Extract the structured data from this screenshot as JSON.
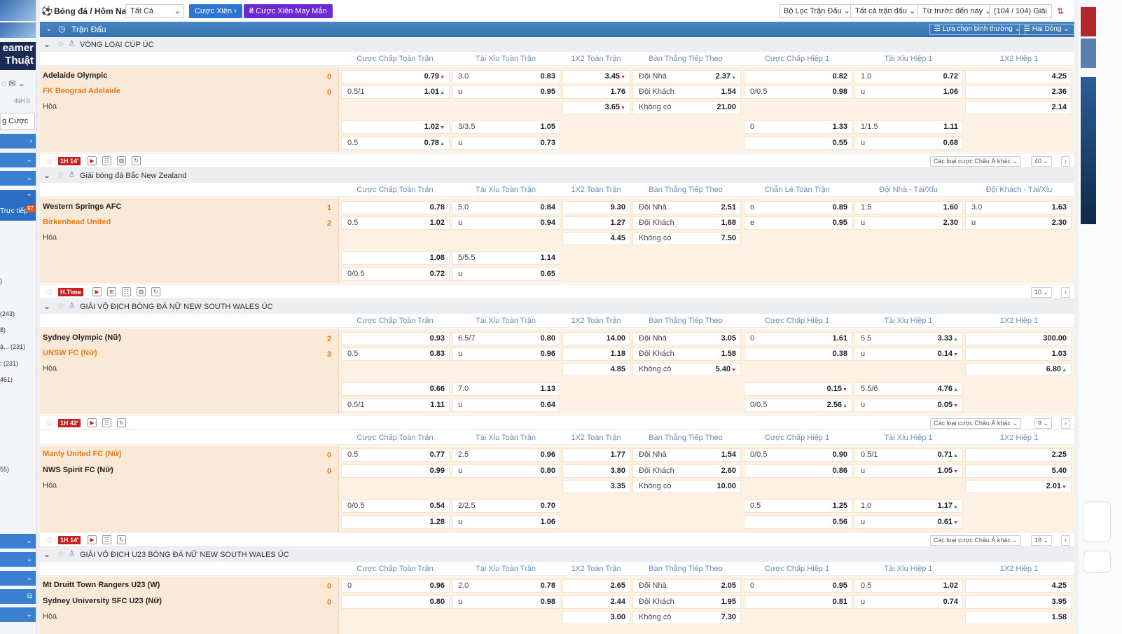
{
  "left_sidebar": {
    "promo_text": "eamer Thuật",
    "new_badge": "NEW",
    "label_inh": "INH 0",
    "bet_label": "g Cược",
    "live_label": "Trực tiếp",
    "live_badge": "97",
    "counts": [
      ")",
      "(243)",
      "8)",
      "ậ... (231)",
      "; (231)",
      "461)",
      "55)"
    ]
  },
  "topbar": {
    "breadcrumb": "Bóng đá / Hôm Nay",
    "all_select": "Tất Cả",
    "parlay_btn": "Cược Xiên",
    "lucky_parlay_btn": "Cược Xiên May Mắn",
    "filter1": "Bộ Lọc Trận Đấu",
    "filter2": "Tất cả trận đấu",
    "filter3": "Từ trước đến nay",
    "league_count": "(104 / 104) Giải"
  },
  "header_bar": {
    "label": "Trận Đấu",
    "select_mode": "Lựa chọn bình thường",
    "two_lines": "Hai Dòng"
  },
  "leagues": [
    {
      "name": "VÒNG LOẠI CÚP ÚC",
      "cols": [
        "Cược Chấp Toàn Trận",
        "Tài Xỉu Toàn Trận",
        "1X2 Toàn Trận",
        "Bàn Thắng Tiếp Theo",
        "Cược Chấp Hiệp 1",
        "Tài Xỉu Hiệp 1",
        "1X2 Hiệp 1"
      ]
    },
    {
      "name": "Giải bóng đá Bắc New Zealand",
      "cols": [
        "Cược Chấp Toàn Trận",
        "Tài Xỉu Toàn Trận",
        "1X2 Toàn Trận",
        "Bàn Thắng Tiếp Theo",
        "Chẵn Lẻ Toàn Trận",
        "Đội Nhà - Tài/Xỉu",
        "Đội Khách - Tài/Xỉu"
      ]
    },
    {
      "name": "GIẢI VÔ ĐỊCH BÓNG ĐÁ NỮ NEW SOUTH WALES ÚC",
      "cols": [
        "Cược Chấp Toàn Trận",
        "Tài Xỉu Toàn Trận",
        "1X2 Toàn Trận",
        "Bàn Thắng Tiếp Theo",
        "Cược Chấp Hiệp 1",
        "Tài Xỉu Hiệp 1",
        "1X2 Hiệp 1"
      ]
    },
    {
      "name": "GIẢI VÔ ĐỊCH U23 BÓNG ĐÁ NỮ NEW SOUTH WALES ÚC",
      "cols": [
        "Cược Chấp Toàn Trận",
        "Tài Xỉu Toàn Trận",
        "1X2 Toàn Trận",
        "Bàn Thắng Tiếp Theo",
        "Cược Chấp Hiệp 1",
        "Tài Xỉu Hiệp 1",
        "1X2 Hiệp 1"
      ]
    }
  ],
  "matches": [
    {
      "home": "Adelaide Olympic",
      "away": "FK Beograd Adelaide",
      "draw": "Hòa",
      "home_score": "0",
      "away_score": "0",
      "time": "1H 14'",
      "more_bets": "Các loại cược Châu Á khác",
      "count": "40",
      "rows": [
        [
          [
            "",
            "0.79",
            "dn"
          ],
          [
            "3.0",
            "0.83",
            ""
          ],
          [
            "",
            "3.45",
            "dn"
          ],
          [
            "Đội Nhà",
            "2.37",
            "up"
          ],
          [
            "",
            "0.82",
            ""
          ],
          [
            "1.0",
            "0.72",
            ""
          ],
          [
            "",
            "4.25",
            ""
          ]
        ],
        [
          [
            "0.5/1",
            "1.01",
            "up"
          ],
          [
            "u",
            "0.95",
            ""
          ],
          [
            "",
            "1.76",
            ""
          ],
          [
            "Đội Khách",
            "1.54",
            ""
          ],
          [
            "0/0.5",
            "0.98",
            ""
          ],
          [
            "u",
            "1.06",
            ""
          ],
          [
            "",
            "2.36",
            ""
          ]
        ],
        [
          null,
          null,
          [
            "",
            "3.65",
            "dn"
          ],
          [
            "Không có",
            "21.00",
            ""
          ],
          null,
          null,
          [
            "",
            "2.14",
            ""
          ]
        ],
        [
          [
            "",
            "1.02",
            "dn"
          ],
          [
            "3/3.5",
            "1.05",
            ""
          ],
          null,
          null,
          [
            "0",
            "1.33",
            ""
          ],
          [
            "1/1.5",
            "1.11",
            ""
          ],
          null
        ],
        [
          [
            "0.5",
            "0.78",
            "up"
          ],
          [
            "u",
            "0.73",
            ""
          ],
          null,
          null,
          [
            "",
            "0.55",
            ""
          ],
          [
            "u",
            "0.68",
            ""
          ],
          null
        ]
      ]
    },
    {
      "home": "Western Springs AFC",
      "away": "Birkenhead United",
      "draw": "Hòa",
      "home_score": "1",
      "away_score": "2",
      "time": "H.Time",
      "more_bets": "",
      "count": "10",
      "rows": [
        [
          [
            "",
            "0.78",
            ""
          ],
          [
            "5.0",
            "0.84",
            ""
          ],
          [
            "",
            "9.30",
            ""
          ],
          [
            "Đội Nhà",
            "2.51",
            ""
          ],
          [
            "o",
            "0.89",
            ""
          ],
          [
            "1.5",
            "1.60",
            ""
          ],
          [
            "3.0",
            "1.63",
            ""
          ]
        ],
        [
          [
            "0.5",
            "1.02",
            ""
          ],
          [
            "u",
            "0.94",
            ""
          ],
          [
            "",
            "1.27",
            ""
          ],
          [
            "Đội Khách",
            "1.68",
            ""
          ],
          [
            "e",
            "0.95",
            ""
          ],
          [
            "u",
            "2.30",
            ""
          ],
          [
            "u",
            "2.30",
            ""
          ]
        ],
        [
          null,
          null,
          [
            "",
            "4.45",
            ""
          ],
          [
            "Không có",
            "7.50",
            ""
          ],
          null,
          null,
          null
        ],
        [
          [
            "",
            "1.08",
            ""
          ],
          [
            "5/5.5",
            "1.14",
            ""
          ],
          null,
          null,
          null,
          null,
          null
        ],
        [
          [
            "0/0.5",
            "0.72",
            ""
          ],
          [
            "u",
            "0.65",
            ""
          ],
          null,
          null,
          null,
          null,
          null
        ]
      ]
    },
    {
      "home": "Sydney Olympic (Nữ)",
      "away": "UNSW FC (Nữ)",
      "draw": "Hòa",
      "home_score": "2",
      "away_score": "3",
      "time": "1H 42'",
      "more_bets": "Các loại cược Châu Á khác",
      "count": "9",
      "rows": [
        [
          [
            "",
            "0.93",
            ""
          ],
          [
            "6.5/7",
            "0.80",
            ""
          ],
          [
            "",
            "14.00",
            ""
          ],
          [
            "Đội Nhà",
            "3.05",
            ""
          ],
          [
            "0",
            "1.61",
            ""
          ],
          [
            "5.5",
            "3.33",
            "up"
          ],
          [
            "",
            "300.00",
            ""
          ]
        ],
        [
          [
            "0.5",
            "0.83",
            ""
          ],
          [
            "u",
            "0.96",
            ""
          ],
          [
            "",
            "1.18",
            ""
          ],
          [
            "Đội Khách",
            "1.58",
            ""
          ],
          [
            "",
            "0.38",
            ""
          ],
          [
            "u",
            "0.14",
            "dn"
          ],
          [
            "",
            "1.03",
            ""
          ]
        ],
        [
          null,
          null,
          [
            "",
            "4.85",
            ""
          ],
          [
            "Không có",
            "5.40",
            "dn"
          ],
          null,
          null,
          [
            "",
            "6.80",
            "up"
          ]
        ],
        [
          [
            "",
            "0.66",
            ""
          ],
          [
            "7.0",
            "1.13",
            ""
          ],
          null,
          null,
          [
            "",
            "0.15",
            "dn"
          ],
          [
            "5.5/6",
            "4.76",
            "up"
          ],
          null
        ],
        [
          [
            "0.5/1",
            "1.11",
            ""
          ],
          [
            "u",
            "0.64",
            ""
          ],
          null,
          null,
          [
            "0/0.5",
            "2.56",
            "up"
          ],
          [
            "u",
            "0.05",
            "dn"
          ],
          null
        ]
      ]
    },
    {
      "home": "Manly United FC (Nữ)",
      "away": "NWS Spirit FC (Nữ)",
      "draw": "Hòa",
      "home_score": "0",
      "away_score": "0",
      "time": "1H 14'",
      "more_bets": "Các loại cược Châu Á khác",
      "count": "19",
      "rows": [
        [
          [
            "0.5",
            "0.77",
            ""
          ],
          [
            "2.5",
            "0.96",
            ""
          ],
          [
            "",
            "1.77",
            ""
          ],
          [
            "Đội Nhà",
            "1.54",
            ""
          ],
          [
            "0/0.5",
            "0.90",
            ""
          ],
          [
            "0.5/1",
            "0.71",
            "up"
          ],
          [
            "",
            "2.25",
            ""
          ]
        ],
        [
          [
            "",
            "0.99",
            ""
          ],
          [
            "u",
            "0.80",
            ""
          ],
          [
            "",
            "3.80",
            ""
          ],
          [
            "Đội Khách",
            "2.60",
            ""
          ],
          [
            "",
            "0.86",
            ""
          ],
          [
            "u",
            "1.05",
            "dn"
          ],
          [
            "",
            "5.40",
            ""
          ]
        ],
        [
          null,
          null,
          [
            "",
            "3.35",
            ""
          ],
          [
            "Không có",
            "10.00",
            ""
          ],
          null,
          null,
          [
            "",
            "2.01",
            "dn"
          ]
        ],
        [
          [
            "0/0.5",
            "0.54",
            ""
          ],
          [
            "2/2.5",
            "0.70",
            ""
          ],
          null,
          null,
          [
            "0.5",
            "1.25",
            ""
          ],
          [
            "1.0",
            "1.17",
            "up"
          ],
          null
        ],
        [
          [
            "",
            "1.28",
            ""
          ],
          [
            "u",
            "1.06",
            ""
          ],
          null,
          null,
          [
            "",
            "0.56",
            ""
          ],
          [
            "u",
            "0.61",
            "dn"
          ],
          null
        ]
      ]
    },
    {
      "home": "Mt Druitt Town Rangers U23 (W)",
      "away": "Sydney University SFC U23 (Nữ)",
      "draw": "Hòa",
      "home_score": "0",
      "away_score": "0",
      "time": "",
      "more_bets": "",
      "count": "",
      "rows": [
        [
          [
            "0",
            "0.96",
            ""
          ],
          [
            "2.0",
            "0.78",
            ""
          ],
          [
            "",
            "2.65",
            ""
          ],
          [
            "Đội Nhà",
            "2.05",
            ""
          ],
          [
            "0",
            "0.95",
            ""
          ],
          [
            "0.5",
            "1.02",
            ""
          ],
          [
            "",
            "4.25",
            ""
          ]
        ],
        [
          [
            "",
            "0.80",
            ""
          ],
          [
            "u",
            "0.98",
            ""
          ],
          [
            "",
            "2.44",
            ""
          ],
          [
            "Đội Khách",
            "1.95",
            ""
          ],
          [
            "",
            "0.81",
            ""
          ],
          [
            "u",
            "0.74",
            ""
          ],
          [
            "",
            "3.95",
            ""
          ]
        ],
        [
          null,
          null,
          [
            "",
            "3.00",
            ""
          ],
          [
            "Không có",
            "7.30",
            ""
          ],
          null,
          null,
          [
            "",
            "1.58",
            ""
          ]
        ]
      ]
    }
  ]
}
